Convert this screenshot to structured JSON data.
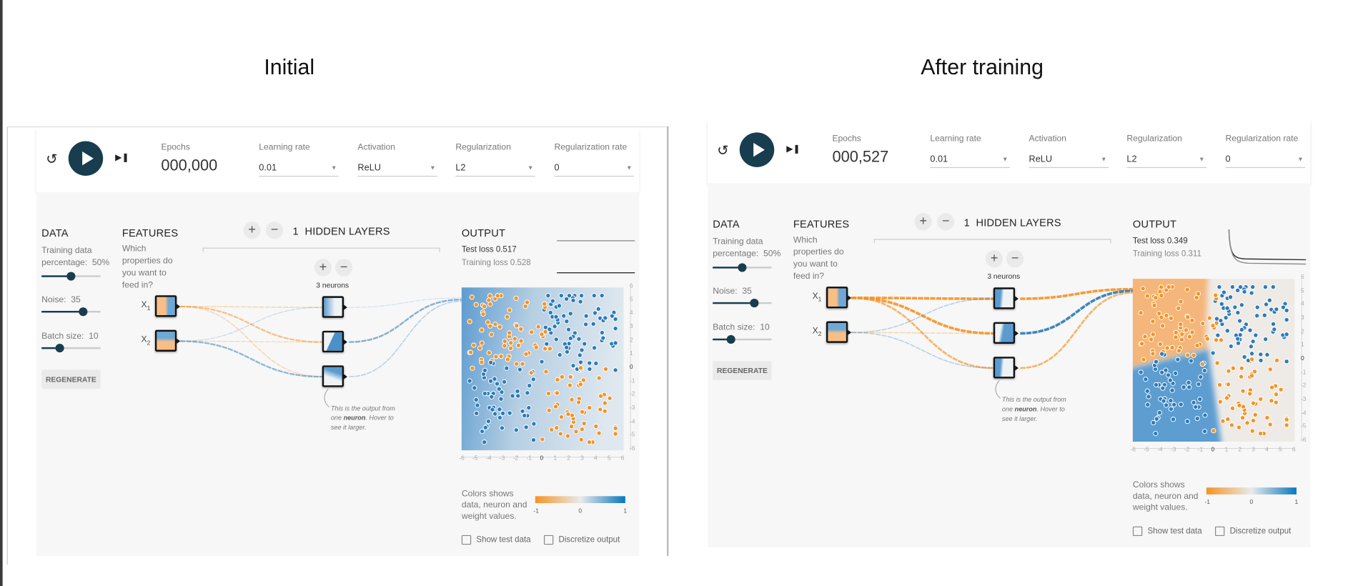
{
  "titles": {
    "initial": "Initial",
    "after": "After training"
  },
  "panels": [
    {
      "name": "initial",
      "epochs_label": "Epochs",
      "epochs_value": "000,000",
      "dropdowns": [
        {
          "label": "Learning rate",
          "value": "0.01"
        },
        {
          "label": "Activation",
          "value": "ReLU"
        },
        {
          "label": "Regularization",
          "value": "L2"
        },
        {
          "label": "Regularization rate",
          "value": "0"
        }
      ],
      "data_heading": "DATA",
      "training_pct_label": "Training data percentage:",
      "training_pct_value": "50%",
      "training_pct": 0.5,
      "noise_label": "Noise:",
      "noise_value": "35",
      "noise_frac": 0.7,
      "batch_label": "Batch size:",
      "batch_value": "10",
      "batch_frac": 0.31,
      "regenerate": "REGENERATE",
      "features_heading": "FEATURES",
      "features_question": "Which properties do you want to feed in?",
      "feature_x1": "X",
      "feature_x1_sub": "1",
      "feature_x2": "X",
      "feature_x2_sub": "2",
      "hidden_count": "1",
      "hidden_label": "HIDDEN LAYERS",
      "neurons_label": "3 neurons",
      "note_pre": "This is the output from one ",
      "note_bold": "neuron",
      "note_post": ". Hover to see it larger.",
      "output_heading": "OUTPUT",
      "test_loss": "Test loss 0.517",
      "training_loss": "Training loss 0.528",
      "legend_text": "Colors shows data, neuron and weight values.",
      "legend_ticks": [
        "-1",
        "0",
        "1"
      ],
      "show_test_data": "Show test data",
      "discretize_output": "Discretize output",
      "axis_ticks": [
        "-6",
        "-5",
        "-4",
        "-3",
        "-2",
        "-1",
        "0",
        "1",
        "2",
        "3",
        "4",
        "5",
        "6"
      ],
      "weights_in": [
        [
          -0.2,
          -0.45,
          -0.2
        ],
        [
          0.1,
          -0.15,
          0.45
        ]
      ],
      "weights_out": [
        0.05,
        0.5,
        0.2
      ]
    },
    {
      "name": "after-training",
      "epochs_label": "Epochs",
      "epochs_value": "000,527",
      "dropdowns": [
        {
          "label": "Learning rate",
          "value": "0.01"
        },
        {
          "label": "Activation",
          "value": "ReLU"
        },
        {
          "label": "Regularization",
          "value": "L2"
        },
        {
          "label": "Regularization rate",
          "value": "0"
        }
      ],
      "data_heading": "DATA",
      "training_pct_label": "Training data percentage:",
      "training_pct_value": "50%",
      "training_pct": 0.5,
      "noise_label": "Noise:",
      "noise_value": "35",
      "noise_frac": 0.7,
      "batch_label": "Batch size:",
      "batch_value": "10",
      "batch_frac": 0.31,
      "regenerate": "REGENERATE",
      "features_heading": "FEATURES",
      "features_question": "Which properties do you want to feed in?",
      "feature_x1": "X",
      "feature_x1_sub": "1",
      "feature_x2": "X",
      "feature_x2_sub": "2",
      "hidden_count": "1",
      "hidden_label": "HIDDEN LAYERS",
      "neurons_label": "3 neurons",
      "note_pre": "This is the output from one ",
      "note_bold": "neuron",
      "note_post": ". Hover to see it larger.",
      "output_heading": "OUTPUT",
      "test_loss": "Test loss 0.349",
      "training_loss": "Training loss 0.311",
      "legend_text": "Colors shows data, neuron and weight values.",
      "legend_ticks": [
        "-1",
        "0",
        "1"
      ],
      "show_test_data": "Show test data",
      "discretize_output": "Discretize output",
      "axis_ticks": [
        "-6",
        "-5",
        "-4",
        "-3",
        "-2",
        "-1",
        "0",
        "1",
        "2",
        "3",
        "4",
        "5",
        "6"
      ],
      "weights_in": [
        [
          -0.9,
          -0.9,
          -0.6
        ],
        [
          0.2,
          -0.2,
          0.2
        ]
      ],
      "weights_out": [
        -0.9,
        0.9,
        -0.6
      ]
    }
  ],
  "colors": {
    "blue": "#2b7bba",
    "orange": "#f59322",
    "dark": "#183d4e"
  }
}
